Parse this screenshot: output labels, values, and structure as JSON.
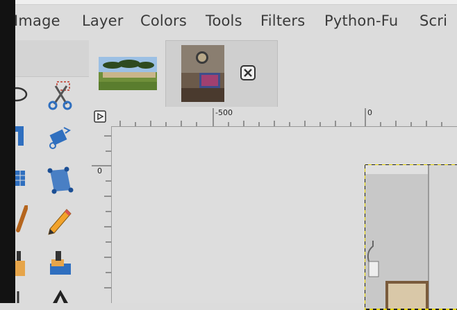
{
  "menu": {
    "items": [
      "Image",
      "Layer",
      "Colors",
      "Tools",
      "Filters",
      "Python-Fu",
      "Scri"
    ]
  },
  "toolbox": {
    "tools": [
      "free-select-icon",
      "scissors-select-icon",
      "align-icon",
      "transform-icon",
      "grid-icon",
      "perspective-icon",
      "brush-icon",
      "pencil-icon",
      "clone-icon",
      "heal-icon",
      "text-icon"
    ]
  },
  "tabs": [
    {
      "name": "pompeii-image",
      "active": false
    },
    {
      "name": "room-image",
      "active": true
    }
  ],
  "ruler": {
    "horizontal_labels": [
      "-500",
      "0"
    ],
    "vertical_labels": [
      "0"
    ]
  },
  "colors": {
    "background": "#dcdcdc",
    "selection_dash": "#e6d400",
    "scissors_red": "#c0392b",
    "tool_blue": "#2f6fbf"
  }
}
